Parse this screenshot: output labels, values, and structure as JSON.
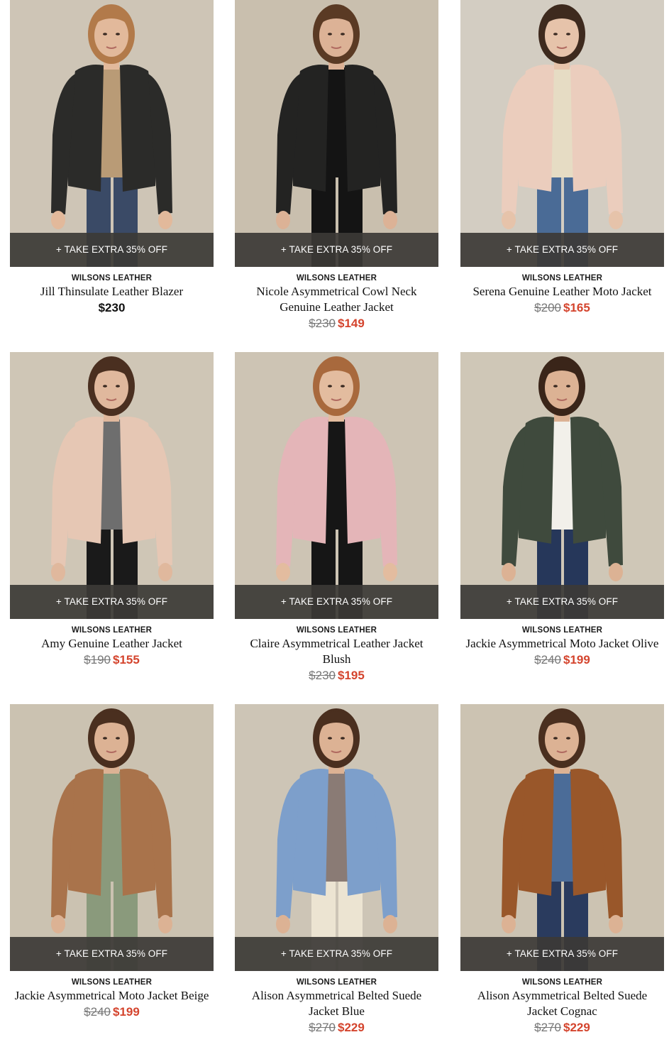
{
  "products": [
    {
      "promo": "+ TAKE EXTRA 35% OFF",
      "brand": "WILSONS LEATHER",
      "name": "Jill Thinsulate Leather Blazer",
      "price": "$230",
      "orig": "",
      "sale": "",
      "colors": {
        "bg": "#cec5b6",
        "jacket": "#2b2b29",
        "inner": "#b99b76",
        "pants": "#3a4a66",
        "skin": "#e2b99b",
        "hair": "#b27a4a"
      }
    },
    {
      "promo": "+ TAKE EXTRA 35% OFF",
      "brand": "WILSONS LEATHER",
      "name": "Nicole Asymmetrical Cowl Neck Genuine Leather Jacket",
      "price": "",
      "orig": "$230",
      "sale": "$149",
      "colors": {
        "bg": "#c9bfae",
        "jacket": "#232322",
        "inner": "#141414",
        "pants": "#141414",
        "skin": "#dcb296",
        "hair": "#5a3a24"
      }
    },
    {
      "promo": "+ TAKE EXTRA 35% OFF",
      "brand": "WILSONS LEATHER",
      "name": "Serena Genuine Leather Moto Jacket",
      "price": "",
      "orig": "$200",
      "sale": "$165",
      "colors": {
        "bg": "#d3cdc2",
        "jacket": "#ebcdbd",
        "inner": "#e6dcc4",
        "pants": "#4a6b96",
        "skin": "#e6c3aa",
        "hair": "#3e2a1e"
      }
    },
    {
      "promo": "+ TAKE EXTRA 35% OFF",
      "brand": "WILSONS LEATHER",
      "name": "Amy Genuine Leather Jacket",
      "price": "",
      "orig": "$190",
      "sale": "$155",
      "colors": {
        "bg": "#cfc6b6",
        "jacket": "#e6c7b4",
        "inner": "#6e6e6e",
        "pants": "#1a1a1a",
        "skin": "#e0b89d",
        "hair": "#4a2f20"
      }
    },
    {
      "promo": "+ TAKE EXTRA 35% OFF",
      "brand": "WILSONS LEATHER",
      "name": "Claire Asymmetrical Leather Jacket Blush",
      "price": "",
      "orig": "$230",
      "sale": "$195",
      "colors": {
        "bg": "#cdc4b4",
        "jacket": "#e4b5b8",
        "inner": "#161616",
        "pants": "#161616",
        "skin": "#e3bc9f",
        "hair": "#a8693d"
      }
    },
    {
      "promo": "+ TAKE EXTRA 35% OFF",
      "brand": "WILSONS LEATHER",
      "name": "Jackie Asymmetrical Moto Jacket Olive",
      "price": "",
      "orig": "$240",
      "sale": "$199",
      "colors": {
        "bg": "#cfc7b7",
        "jacket": "#3f4a3d",
        "inner": "#f2f0ea",
        "pants": "#26375a",
        "skin": "#dcb294",
        "hair": "#3a2519"
      }
    },
    {
      "promo": "+ TAKE EXTRA 35% OFF",
      "brand": "WILSONS LEATHER",
      "name": "Jackie Asymmetrical Moto Jacket Beige",
      "price": "",
      "orig": "$240",
      "sale": "$199",
      "colors": {
        "bg": "#cbc2b1",
        "jacket": "#a9734b",
        "inner": "#8a9a7c",
        "pants": "#8a9a7c",
        "skin": "#dcb294",
        "hair": "#4a2f1f"
      }
    },
    {
      "promo": "+ TAKE EXTRA 35% OFF",
      "brand": "WILSONS LEATHER",
      "name": "Alison Asymmetrical Belted Suede Jacket Blue",
      "price": "",
      "orig": "$270",
      "sale": "$229",
      "colors": {
        "bg": "#cdc5b6",
        "jacket": "#7d9fcb",
        "inner": "#8a7b75",
        "pants": "#ece4d2",
        "skin": "#dcb294",
        "hair": "#4a2f1f"
      }
    },
    {
      "promo": "+ TAKE EXTRA 35% OFF",
      "brand": "WILSONS LEATHER",
      "name": "Alison Asymmetrical Belted Suede Jacket Cognac",
      "price": "",
      "orig": "$270",
      "sale": "$229",
      "colors": {
        "bg": "#ccc3b2",
        "jacket": "#99572a",
        "inner": "#4b6c98",
        "pants": "#2a3b5e",
        "skin": "#dcb294",
        "hair": "#4a2f1f"
      }
    }
  ]
}
